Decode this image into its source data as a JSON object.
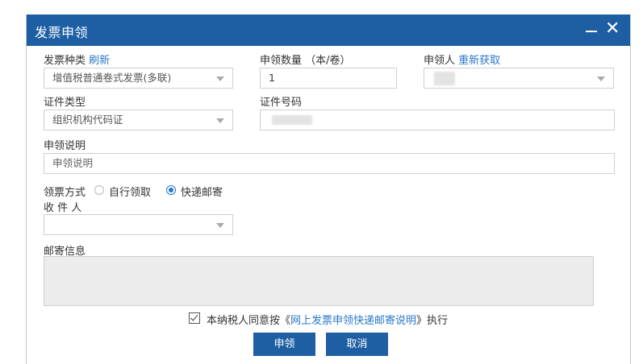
{
  "dialog": {
    "title": "发票申领",
    "minimize_symbol": "—",
    "close_symbol": "✕"
  },
  "form": {
    "invoice_type": {
      "label": "发票种类",
      "action": "刷新",
      "value": "增值税普通卷式发票(多联)"
    },
    "quantity": {
      "label": "申领数量 （本/卷）",
      "value": "1"
    },
    "applicant": {
      "label": "申领人",
      "action": "重新获取",
      "value": ""
    },
    "id_type": {
      "label": "证件类型",
      "value": "组织机构代码证"
    },
    "id_number": {
      "label": "证件号码",
      "value": ""
    },
    "description": {
      "label": "申领说明",
      "placeholder": "申领说明"
    },
    "pickup": {
      "label": "领票方式",
      "options": [
        {
          "label": "自行领取",
          "selected": false
        },
        {
          "label": "快递邮寄",
          "selected": true
        }
      ]
    },
    "recipient": {
      "label": "收 件 人",
      "value": ""
    },
    "mail_info": {
      "label": "邮寄信息",
      "value": ""
    },
    "agreement": {
      "checked": true,
      "prefix": "本纳税人同意按《",
      "link": "网上发票申领快递邮寄说明",
      "suffix": "》执行"
    }
  },
  "buttons": {
    "submit": "申领",
    "cancel": "取消"
  },
  "colors": {
    "titlebar": "#1e5fa3",
    "link": "#2878c8",
    "button": "#1e5fa3"
  }
}
